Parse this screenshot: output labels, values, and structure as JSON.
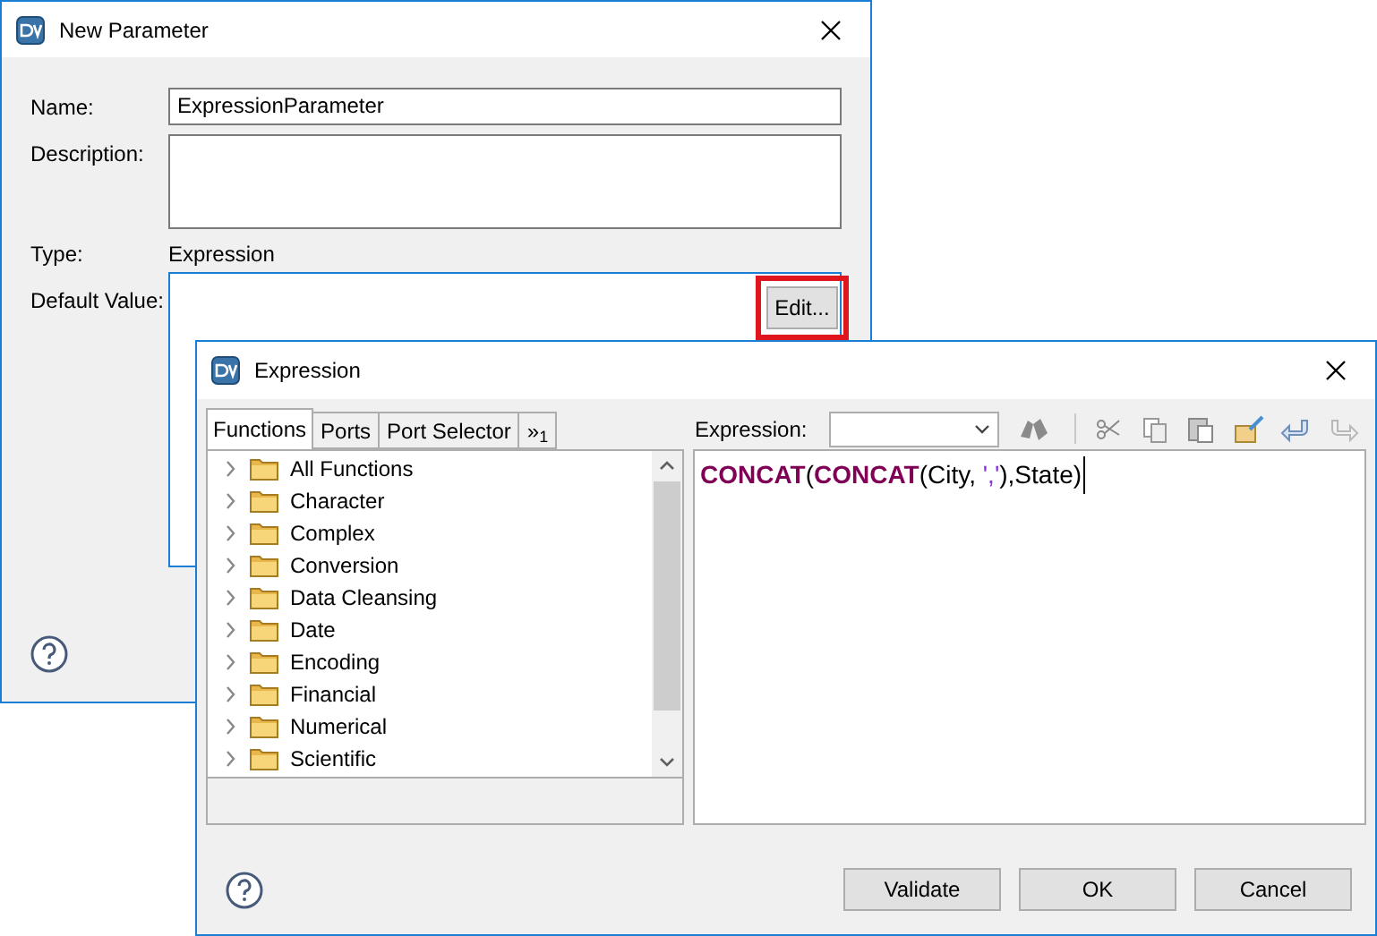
{
  "parameter_window": {
    "title": "New Parameter",
    "fields": [
      {
        "label": "Name:",
        "kind": "input",
        "value": "ExpressionParameter"
      },
      {
        "label": "Description:",
        "kind": "textarea"
      },
      {
        "label": "Type:",
        "kind": "text",
        "value": "Expression"
      },
      {
        "label": "Default Value:",
        "kind": "default"
      }
    ],
    "edit_button": {
      "label": "Edit...",
      "highlighted": true
    }
  },
  "expression_window": {
    "title": "Expression",
    "tabs": [
      {
        "label": "Functions",
        "selected": true
      },
      {
        "label": "Ports",
        "selected": false
      },
      {
        "label": "Port Selector",
        "selected": false
      },
      {
        "label": "»$_{1}$",
        "selected": false
      }
    ],
    "tree": [
      {
        "label": "All Functions",
        "expanded": false
      },
      {
        "label": "Character",
        "expanded": false
      },
      {
        "label": "Complex",
        "expanded": false
      },
      {
        "label": "Conversion",
        "expanded": false
      },
      {
        "label": "Data Cleansing",
        "expanded": false
      },
      {
        "label": "Date",
        "expanded": false
      },
      {
        "label": "Encoding",
        "expanded": false
      },
      {
        "label": "Financial",
        "expanded": false
      },
      {
        "label": "Numerical",
        "expanded": false
      },
      {
        "label": "Scientific",
        "expanded": false
      }
    ],
    "expression_label": "Expression:",
    "expression": [
      {
        "kind": "keyword",
        "text": "CONCAT"
      },
      {
        "kind": "plain",
        "text": "("
      },
      {
        "kind": "keyword",
        "text": "CONCAT"
      },
      {
        "kind": "plain",
        "text": "(City, "
      },
      {
        "kind": "string",
        "text": "','"
      },
      {
        "kind": "plain",
        "text": "),State)"
      }
    ],
    "buttons": [
      "Validate",
      "OK",
      "Cancel"
    ]
  }
}
